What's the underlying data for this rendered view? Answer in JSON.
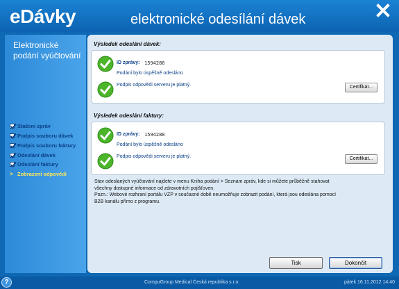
{
  "header": {
    "logo": "eDávky",
    "title": "elektronické odesílání dávek",
    "close_icon": "close-icon"
  },
  "sidebar": {
    "title": "Elektronické podání vyúčtování",
    "items": [
      {
        "label": "Stažení zpráv",
        "state": "done"
      },
      {
        "label": "Podpis souboru dávek",
        "state": "done"
      },
      {
        "label": "Podpis souboru faktury",
        "state": "done"
      },
      {
        "label": "Odeslání dávek",
        "state": "done"
      },
      {
        "label": "Odeslání faktury",
        "state": "done"
      },
      {
        "label": "Zobrazení odpovědi",
        "state": "active"
      }
    ]
  },
  "main": {
    "batch_section": {
      "title": "Výsledek odeslání dávek:",
      "id_label": "ID zprávy:",
      "id_value": "1594286",
      "sent_text": "Podání bylo úspěšně odesláno",
      "signature_text": "Podpis odpovědi serveru je platný.",
      "cert_button": "Certifikát..."
    },
    "invoice_section": {
      "title": "Výsledek odeslání faktury:",
      "id_label": "ID zprávy:",
      "id_value": "1594288",
      "sent_text": "Podání bylo úspěšně odesláno",
      "signature_text": "Podpis odpovědi serveru je platný.",
      "cert_button": "Certifikát..."
    },
    "info": {
      "line1": "Stav odeslaných vyúčtování najdete v menu Kniha podání > Seznam zpráv, kde si můžete průběžně stahovat",
      "line2": "všechny dostupné informace od zdravotních pojišťoven.",
      "line3": "Pozn.: Webové rozhraní portálu VZP v současné době neumožňuje zobrazit podání, která jsou odeslána pomocí",
      "line4": "B2B kanálu přímo z programu."
    },
    "buttons": {
      "print": "Tisk",
      "finish": "Dokončit"
    }
  },
  "statusbar": {
    "help": "?",
    "company": "CompuGroup Medical Česká republika s.r.o.",
    "datetime": "pátek 16.11.2012 14:40"
  },
  "colors": {
    "background": "#0f68b4",
    "accent_yellow": "#ffe85a",
    "panel": "#ddeaf6",
    "success_green": "#4cb52a"
  }
}
